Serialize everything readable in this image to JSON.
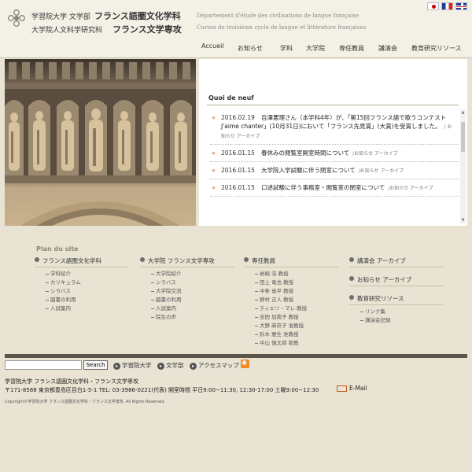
{
  "header": {
    "univ_line1": "学習院大学 文学部",
    "univ_line2": "大学院人文科学研究科",
    "dept_line1": "フランス語圏文化学科",
    "dept_line2": "フランス文学専攻",
    "fr_line1": "Département d'étude des civilisations de langue française",
    "fr_line2": "Cursus de troisième cycle de langue et littérature françaises",
    "flags": [
      "japanese-flag",
      "french-flag",
      "english-flag"
    ]
  },
  "nav": {
    "items": [
      "Accueil",
      "お知らせ",
      "学科",
      "大学院",
      "専任教員",
      "講演会",
      "教育研究リソース"
    ]
  },
  "news": {
    "title": "Quoi de neuf",
    "items": [
      {
        "date": "2016.02.19",
        "text": "百澤悪理さん（本学科4年）が、「第15回フランス語で歌うコンテスト J'aime chanter」(10月31日)において「フランス先見賞」(大賞)を受賞しました。",
        "meta": "/ お知らせ アーカイブ"
      },
      {
        "date": "2016.01.15",
        "text": "春休みの閲覧室開室時間について",
        "meta": "/お知らせ アーカイブ"
      },
      {
        "date": "2016.01.15",
        "text": "大学院入学試験に伴う閉室について",
        "meta": "/お知らせ アーカイブ"
      },
      {
        "date": "2016.01.15",
        "text": "口述試験に伴う事務室・閲覧室の閉室について",
        "meta": "/お知らせ アーカイブ"
      }
    ]
  },
  "sitemap": {
    "title": "Plan du site",
    "columns": [
      {
        "head": "フランス語圏文化学科",
        "items": [
          "学科紹介",
          "カリキュラム",
          "シラバス",
          "図書の利用",
          "入試案内"
        ]
      },
      {
        "head": "大学院 フランス文学専攻",
        "items": [
          "大学院紹介",
          "シラバス",
          "大学院交流",
          "図書の利用",
          "入試案内",
          "院生の声"
        ]
      },
      {
        "head": "専任教員",
        "items": [
          "岩崎 浩 教授",
          "田上 竜也 教授",
          "中条 省平 教授",
          "野村 正人 教授",
          "ティエリ・マレ 教授",
          "吉田 加南子 教授",
          "大野 麻奈子 准教授",
          "鈴木 雅生 准教授",
          "中山 慎太郎 助教"
        ]
      },
      {
        "head": "講演会 アーカイブ",
        "items": []
      },
      {
        "head": "お知らせ アーカイブ",
        "items": []
      },
      {
        "head": "教育研究リソース",
        "items": [
          "リンク集",
          "講演会記録"
        ]
      }
    ]
  },
  "footer": {
    "search_button": "Search",
    "links": [
      "学習院大学",
      "文学部",
      "アクセスマップ"
    ],
    "address_line1": "学習院大学 フランス語圏文化学科・フランス文学専攻",
    "address_line2": "〒171-8588 東京都豊島区目白1-5-1 TEL: 03-3986-0221(代表) 開室時間 平日9:00~11:30, 12:30-17:00 土曜9:00~12:30",
    "email": "E-Mail",
    "copyright": "Copyright©学習院大学 フランス語圏文化学科・フランス文学専攻. All Rights Reserved."
  }
}
